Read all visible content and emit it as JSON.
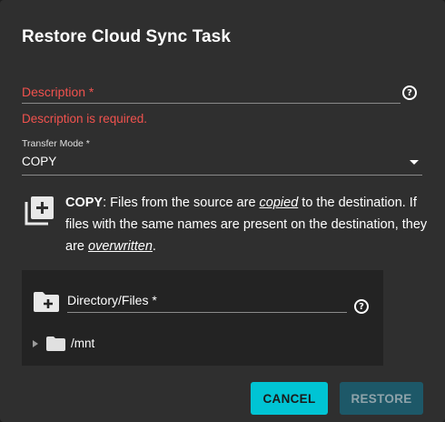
{
  "dialog": {
    "title": "Restore Cloud Sync Task"
  },
  "description": {
    "label": "Description *",
    "error": "Description is required.",
    "help_icon": "help-circle-icon"
  },
  "transfer_mode": {
    "label": "Transfer Mode *",
    "value": "COPY"
  },
  "copy_info": {
    "mode": "COPY",
    "text_1": ": Files from the source are ",
    "em_1": "copied",
    "text_2": " to the destination. If files with the same names are present on the destination, they are ",
    "em_2": "overwritten",
    "text_3": "."
  },
  "directory": {
    "label": "Directory/Files *",
    "help_icon": "help-circle-icon",
    "tree": [
      {
        "label": "/mnt",
        "expanded": false
      }
    ]
  },
  "actions": {
    "cancel_label": "CANCEL",
    "restore_label": "RESTORE",
    "restore_disabled": true
  },
  "colors": {
    "background": "#2f2f2f",
    "error": "#f0524e",
    "accent": "#00c4d4",
    "disabled_button": "#1d5868"
  }
}
